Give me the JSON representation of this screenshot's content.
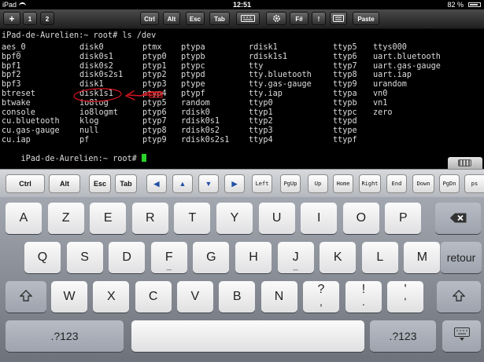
{
  "status_bar": {
    "carrier": "iPad",
    "time": "12:51",
    "battery": "82 %"
  },
  "top_toolbar": {
    "add": "+",
    "tab1": "1",
    "tab2": "2",
    "ctrl": "Ctrl",
    "alt": "Alt",
    "esc": "Esc",
    "tab": "Tab",
    "fn": "F#",
    "pipe": "!",
    "paste": "Paste"
  },
  "terminal": {
    "command_line": "iPad-de-Aurelien:~ root# ls /dev",
    "rows": [
      [
        "aes_0",
        "disk0",
        "ptmx",
        "ptypa",
        "rdisk1",
        "ttyp5",
        "ttys000"
      ],
      [
        "bpf0",
        "disk0s1",
        "ptyp0",
        "ptypb",
        "rdisk1s1",
        "ttyp6",
        "uart.bluetooth"
      ],
      [
        "bpf1",
        "disk0s2",
        "ptyp1",
        "ptypc",
        "tty",
        "ttyp7",
        "uart.gas-gauge"
      ],
      [
        "bpf2",
        "disk0s2s1",
        "ptyp2",
        "ptypd",
        "tty.bluetooth",
        "ttyp8",
        "uart.iap"
      ],
      [
        "bpf3",
        "disk1",
        "ptyp3",
        "ptype",
        "tty.gas-gauge",
        "ttyp9",
        "urandom"
      ],
      [
        "btreset",
        "disk1s1",
        "ptyp4",
        "ptypf",
        "tty.iap",
        "ttypa",
        "vn0"
      ],
      [
        "btwake",
        "io8log",
        "ptyp5",
        "random",
        "ttyp0",
        "ttypb",
        "vn1"
      ],
      [
        "console",
        "io8logmt",
        "ptyp6",
        "rdisk0",
        "ttyp1",
        "ttypc",
        "zero"
      ],
      [
        "cu.bluetooth",
        "klog",
        "ptyp7",
        "rdisk0s1",
        "ttyp2",
        "ttypd",
        ""
      ],
      [
        "cu.gas-gauge",
        "null",
        "ptyp8",
        "rdisk0s2",
        "ttyp3",
        "ttype",
        ""
      ],
      [
        "cu.iap",
        "pf",
        "ptyp9",
        "rdisk0s2s1",
        "ttyp4",
        "ttypf",
        ""
      ]
    ],
    "prompt": "iPad-de-Aurelien:~ root#"
  },
  "key_toolbar": {
    "ctrl": "Ctrl",
    "alt": "Alt",
    "esc": "Esc",
    "tab": "Tab",
    "left_arrow": "◀",
    "up_arrow": "▲",
    "down_arrow": "▼",
    "right_arrow": "▶",
    "left": "Left",
    "pgup": "PgUp",
    "up": "Up",
    "home": "Home",
    "right": "Right",
    "end": "End",
    "down": "Down",
    "pgdn": "PgDn",
    "ps": "ps"
  },
  "keyboard": {
    "row1": [
      "A",
      "Z",
      "E",
      "R",
      "T",
      "Y",
      "U",
      "I",
      "O",
      "P"
    ],
    "row2": [
      "Q",
      "S",
      "D",
      "F",
      "G",
      "H",
      "J",
      "K",
      "L",
      "M"
    ],
    "f_sub": "_",
    "j_sub": "_",
    "return": "retour",
    "row3": [
      "W",
      "X",
      "C",
      "V",
      "B",
      "N"
    ],
    "comma_top": "?",
    "comma_bottom": ",",
    "period_top": "!",
    "period_bottom": ".",
    "quote_top": "'",
    "quote_bottom": "'",
    "numbers": ".?123"
  },
  "colors": {
    "cursor": "#2bd42b",
    "annotation": "#d8141e"
  }
}
